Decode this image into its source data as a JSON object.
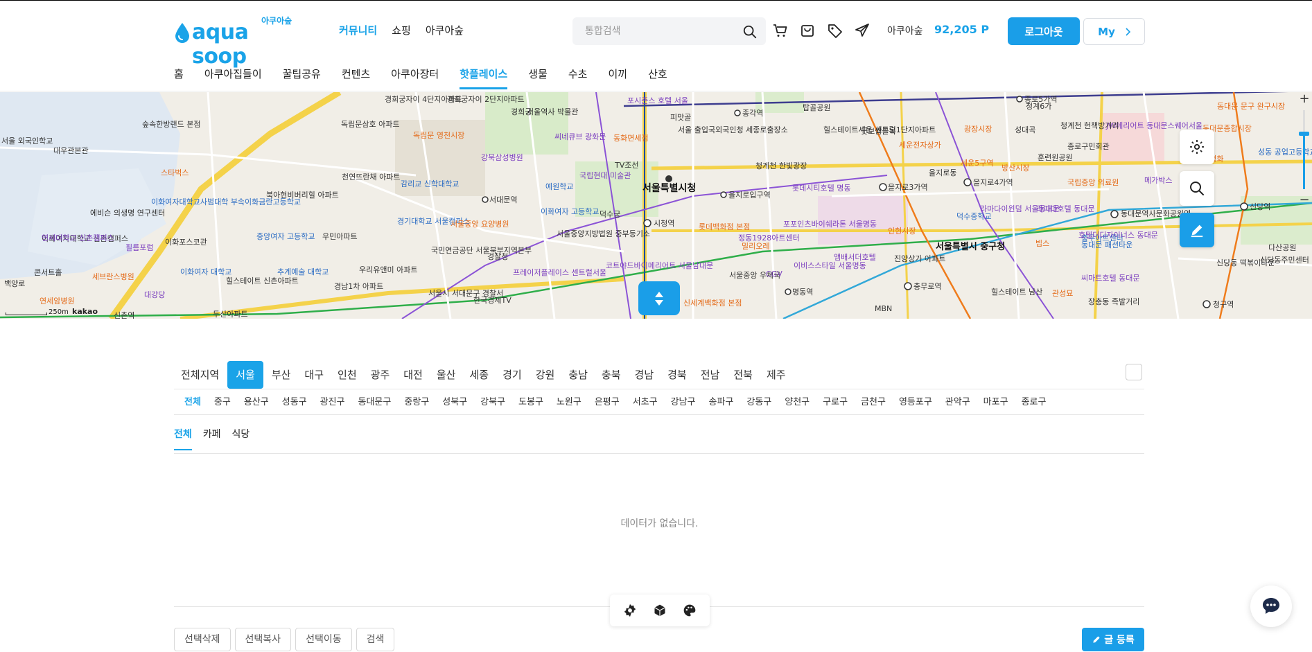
{
  "header": {
    "logo_text": "aqua soop",
    "logo_korean": "아쿠아숲",
    "gnb": [
      "커뮤니티",
      "쇼핑",
      "아쿠아숲"
    ],
    "gnb_active": 0,
    "search_placeholder": "통합검색",
    "user_name": "아쿠아숲",
    "points": "92,205 P",
    "logout_label": "로그아웃",
    "my_label": "My"
  },
  "subnav": {
    "items": [
      "홈",
      "아쿠아집들이",
      "꿀팁공유",
      "컨텐츠",
      "아쿠아장터",
      "핫플레이스",
      "생물",
      "수초",
      "이끼",
      "산호"
    ],
    "active": 5
  },
  "map": {
    "scale_label": "250m",
    "provider": "kakao",
    "zoom_level": 0.7,
    "labels": [
      "서울특별시청",
      "서울특별시 중구청",
      "시청역",
      "을지로입구역",
      "을지로3가역",
      "을지로4가역",
      "종각역",
      "동대문역사문화공원역",
      "충무로역",
      "명동역",
      "서대문역",
      "종로5가역",
      "신당역",
      "청구역",
      "숲속한방랜드 본점",
      "스타벅스",
      "이화여자대학교 신촌캠퍼스",
      "세브란스병원",
      "독립문 영천시장",
      "경희궁자이 4단지아파트",
      "경희궁자이 2단지아파트",
      "강북삼성병원",
      "씨네큐브 광화문",
      "포시즌스 호텔 서울",
      "TV조선",
      "국립현대 미술관",
      "동화면세점",
      "롯데시티호텔 명동",
      "롯데백화점 본점",
      "신세계백화점 본점",
      "힐스테이트세운 센트럴1단지아파트",
      "세운전자상가",
      "광장시장",
      "방산시장",
      "훈련원공원",
      "국립중앙 의료원",
      "메가박스",
      "덕수중학교",
      "서울중앙 우체국",
      "코트야드바이메리어트 서울남대문",
      "프레이저플레이스 센트럴서울",
      "한국경제TV",
      "경기대학교 서울캠퍼스",
      "감리교 신학대학교",
      "천연뜨란채 아파트",
      "독립문삼호 아파트",
      "북아현비버리힐 아파트",
      "우민아파트",
      "중앙여자 고등학교",
      "추계예술 대학교",
      "이화여자 대학교",
      "힐스테이트 신촌아파트",
      "우리유앤미 아파트",
      "경남1차 아파트",
      "서울중앙지방법원 중부등기소",
      "이화여자 고등학교",
      "예원학교",
      "덕수궁",
      "경찰청",
      "국민연금공단 서울북부지역본부",
      "CGV",
      "MBN",
      "밀리오레",
      "정동1928아트센터",
      "이비스스타일 서울명동",
      "앰배서더호텔",
      "진양상가 아파트",
      "힐스테이트 남산",
      "관성묘",
      "라마다호텔 동대문",
      "JW메리어트 동대문스퀘어서울",
      "동대문 문구 완구시장",
      "동대문종합시장",
      "제일평화",
      "성동 공업고등학교",
      "다산공원",
      "신당동 떡볶이타운",
      "신당동주민센터",
      "충무아트센터",
      "장충동 족발거리",
      "청계천 헌책방거리",
      "종로구민회관",
      "동대문 패션타운",
      "서울 외국인학교",
      "대우관본관",
      "에비슨 의생명 연구센터",
      "연세대학교 신촌캠퍼스",
      "필름포럼",
      "대강당",
      "백양로",
      "연세암병원",
      "콘서트홀",
      "이화포스코관",
      "피맛골",
      "탑골공원",
      "굿보쌈골목",
      "청계천 한빛광장",
      "포포인츠바이쉐라톤 서울명동",
      "인현시장",
      "빕스",
      "세운5구역",
      "을지로동",
      "두산아파트",
      "신촌역",
      "서울시 서대문구 경찰서",
      "서울 출입국외국인청 세종로출장소",
      "라마다이윈덤 서울동대문",
      "호텔더디자이너스 동대문",
      "씨마트호텔 동대문",
      "성대곡",
      "청계6가",
      "경희궁",
      "서울역사 박물관",
      "서울중앙 요양병원",
      "이화여자대학교사범대학 부속이화금란고등학교"
    ]
  },
  "regions": {
    "items": [
      "전체지역",
      "서울",
      "부산",
      "대구",
      "인천",
      "광주",
      "대전",
      "울산",
      "세종",
      "경기",
      "강원",
      "충남",
      "충북",
      "경남",
      "경북",
      "전남",
      "전북",
      "제주"
    ],
    "active": 1
  },
  "districts": {
    "items": [
      "전체",
      "중구",
      "용산구",
      "성동구",
      "광진구",
      "동대문구",
      "중랑구",
      "성북구",
      "강북구",
      "도봉구",
      "노원구",
      "은평구",
      "서초구",
      "강남구",
      "송파구",
      "강동구",
      "양천구",
      "구로구",
      "금천구",
      "영등포구",
      "관악구",
      "마포구",
      "종로구"
    ],
    "active": 0
  },
  "categories": {
    "items": [
      "전체",
      "카페",
      "식당"
    ],
    "active": 0
  },
  "list": {
    "empty_text": "데이터가 없습니다."
  },
  "actions": {
    "buttons": [
      "선택삭제",
      "선택복사",
      "선택이동",
      "검색"
    ],
    "write_label": "글 등록"
  },
  "colors": {
    "accent": "#1aa3e8",
    "button_primary": "#1a9ee8"
  }
}
